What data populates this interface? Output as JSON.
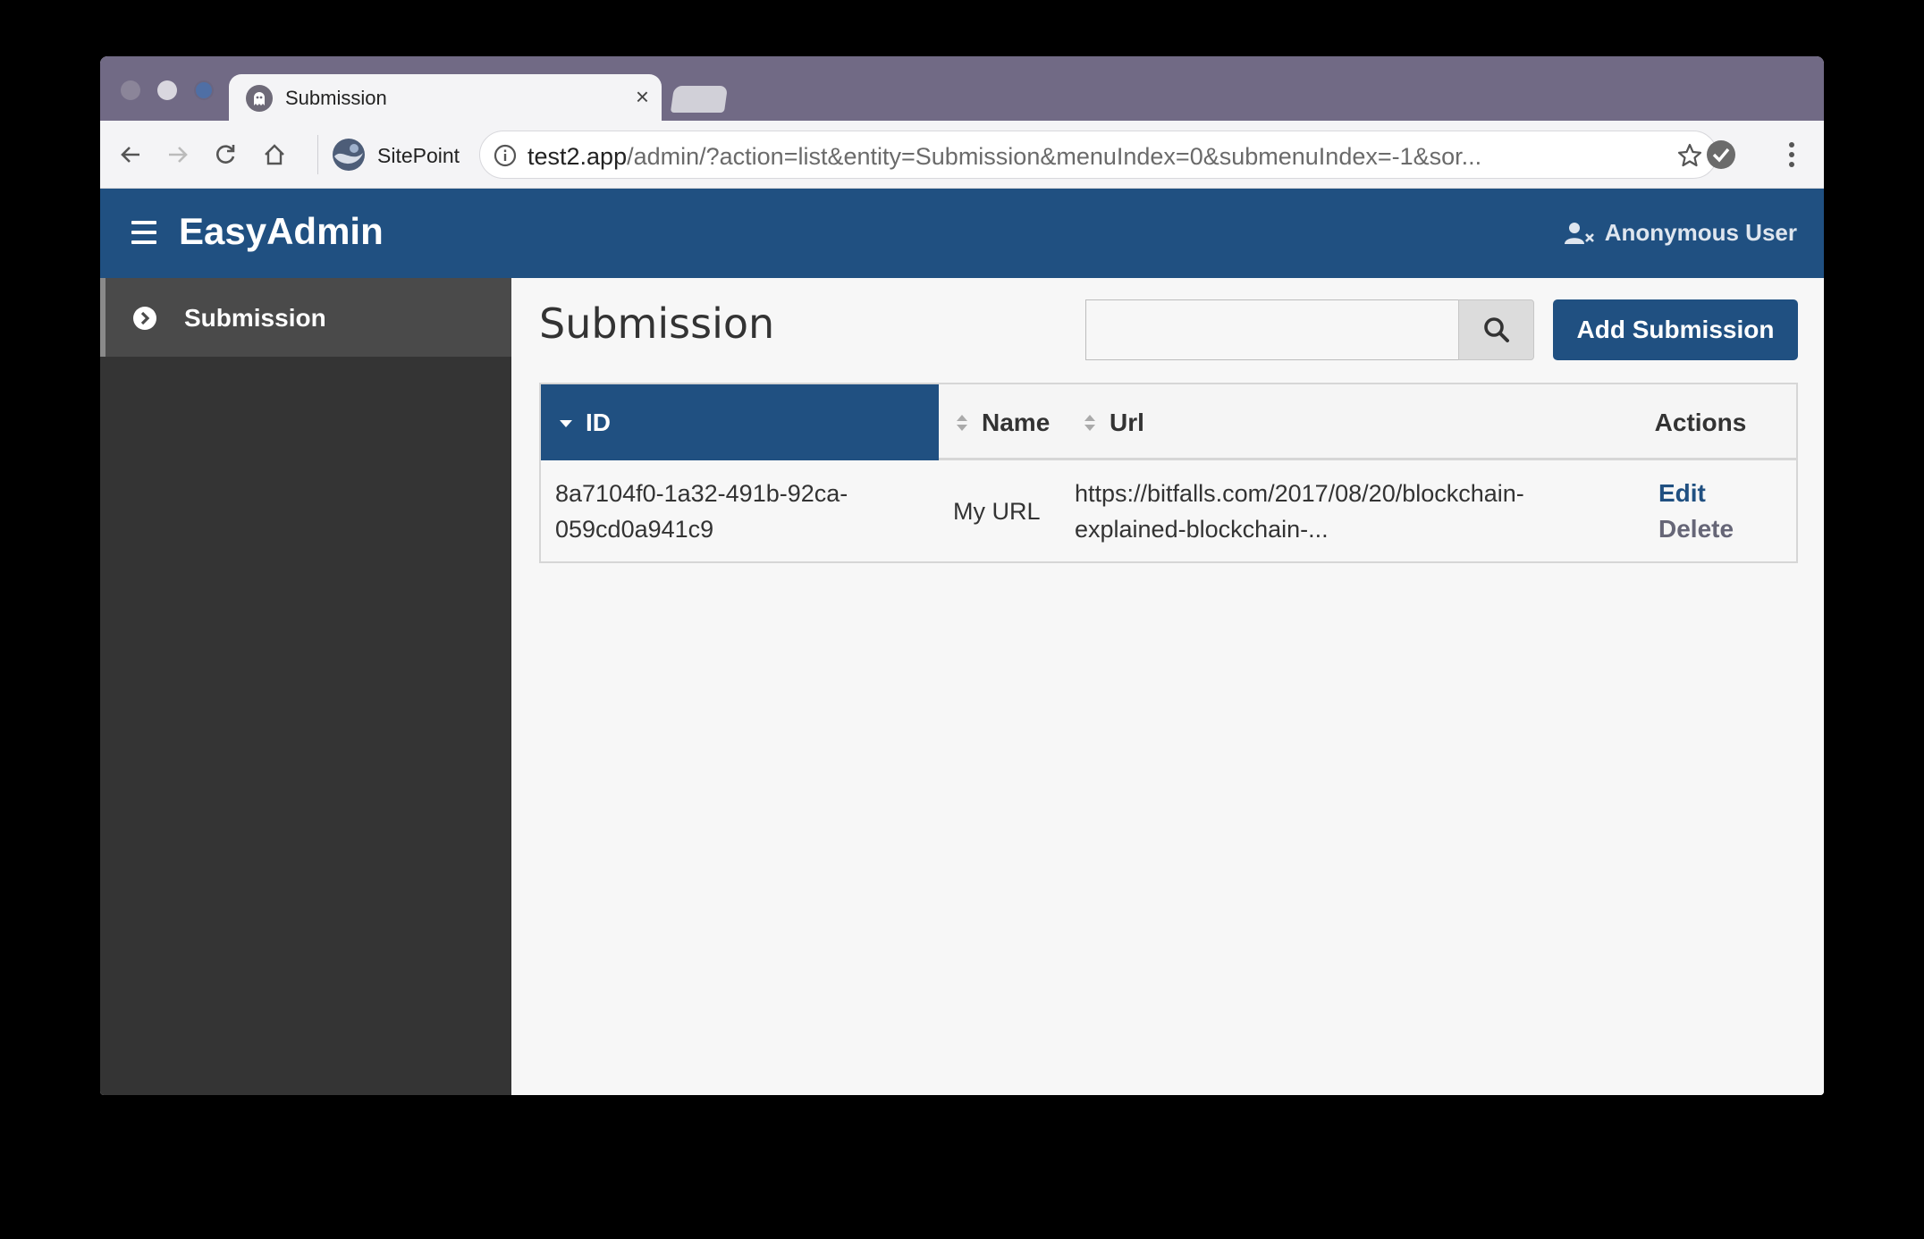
{
  "browser": {
    "tab_title": "Submission",
    "bookmark_label": "SitePoint",
    "url_host": "test2.app",
    "url_path": "/admin/?action=list&entity=Submission&menuIndex=0&submenuIndex=-1&sor..."
  },
  "header": {
    "brand": "EasyAdmin",
    "user": "Anonymous User"
  },
  "sidebar": {
    "items": [
      {
        "label": "Submission"
      }
    ]
  },
  "main": {
    "title": "Submission",
    "search": {
      "value": "",
      "placeholder": ""
    },
    "add_button": "Add Submission"
  },
  "table": {
    "columns": [
      "ID",
      "Name",
      "Url",
      "Actions"
    ],
    "rows": [
      {
        "id_line1": "8a7104f0-1a32-491b-92ca-",
        "id_line2": "059cd0a941c9",
        "name": "My URL",
        "url_line1": "https://bitfalls.com/2017/08/20/blockchain-",
        "url_line2": "explained-blockchain-...",
        "edit": "Edit",
        "delete": "Delete"
      }
    ]
  },
  "colors": {
    "primary": "#205081",
    "sidebar_bg": "#343434",
    "tabstrip": "#716a85"
  }
}
